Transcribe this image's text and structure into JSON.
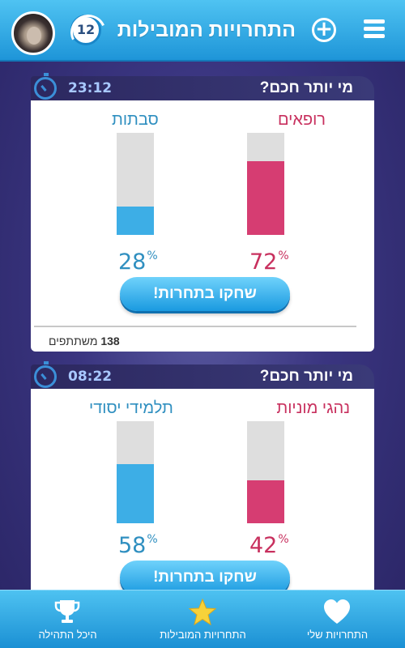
{
  "header": {
    "title": "התחרויות המובילות",
    "badge_count": "12",
    "menu_icon": "hamburger-menu-icon",
    "add_icon": "plus-circle-icon"
  },
  "challenges": [
    {
      "title": "מי יותר חכם?",
      "timer": "23:12",
      "team_right": {
        "name": "רופאים",
        "percent": "72",
        "color": "#d63d72"
      },
      "team_left": {
        "name": "סבתות",
        "percent": "28",
        "color": "#3daee6"
      },
      "play_label": "שחקו בתחרות!",
      "participants_count": "138",
      "participants_label": "משתתפים"
    },
    {
      "title": "מי יותר חכם?",
      "timer": "08:22",
      "team_right": {
        "name": "נהגי מוניות",
        "percent": "42",
        "color": "#d63d72"
      },
      "team_left": {
        "name": "תלמידי יסודי",
        "percent": "58",
        "color": "#3daee6"
      },
      "play_label": "שחקו בתחרות!"
    }
  ],
  "bottom_nav": {
    "items": [
      {
        "label": "התחרויות שלי",
        "icon": "heart-icon"
      },
      {
        "label": "התחרויות המובילות",
        "icon": "star-icon"
      },
      {
        "label": "היכל התהילה",
        "icon": "trophy-icon"
      }
    ]
  },
  "percent_symbol": "%"
}
